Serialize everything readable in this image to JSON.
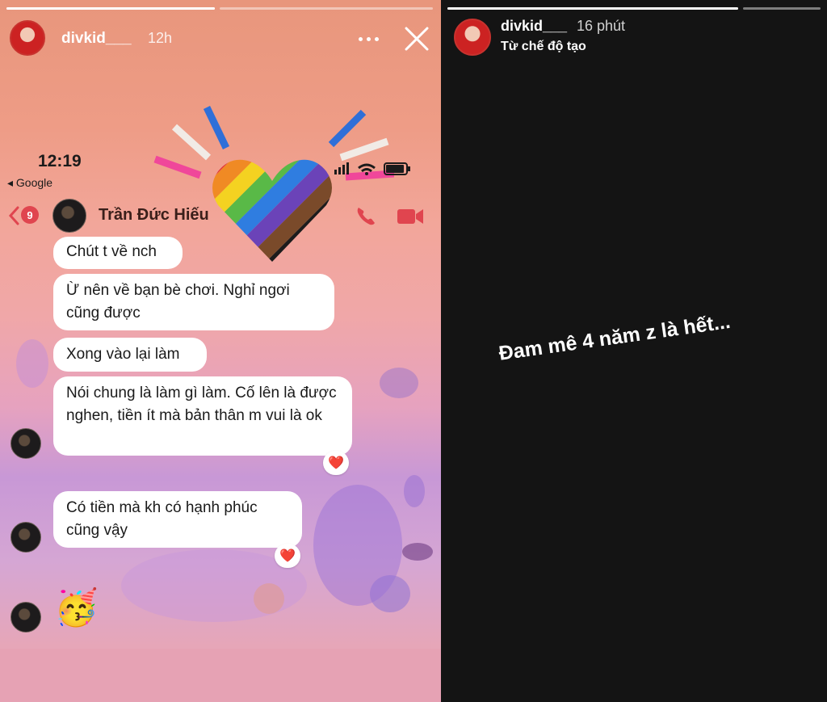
{
  "left_story": {
    "username": "divkid___",
    "time": "12h",
    "more_icon": "more-dots-icon",
    "close_icon": "close-icon",
    "progress": [
      1.0,
      0.0
    ],
    "screenshot": {
      "status_time": "12:19",
      "back_app": "◂ Google",
      "unread_count": "9",
      "contact_name": "Trần Đức Hiếu",
      "messages": [
        {
          "text": "Chút t về nch"
        },
        {
          "text": "Ừ nên về bạn bè chơi. Nghỉ ngơi cũng được"
        },
        {
          "text": "Xong vào lại làm"
        },
        {
          "text": "Nói chung là làm gì làm. Cố lên là được nghen, tiền ít mà bản thân m vui là ok",
          "reaction": "❤️"
        },
        {
          "text": "Có tiền mà kh có hạnh phúc cũng vậy",
          "reaction": "❤️"
        }
      ],
      "emoji": "🥳"
    },
    "sticker": "rainbow-heart-sticker"
  },
  "right_story": {
    "username": "divkid___",
    "time": "16 phút",
    "subtitle": "Từ chế độ tạo",
    "caption": "Đam mê 4 năm z là hết..."
  },
  "colors": {
    "accent_red": "#e0454f",
    "dark_bg": "#141414"
  }
}
